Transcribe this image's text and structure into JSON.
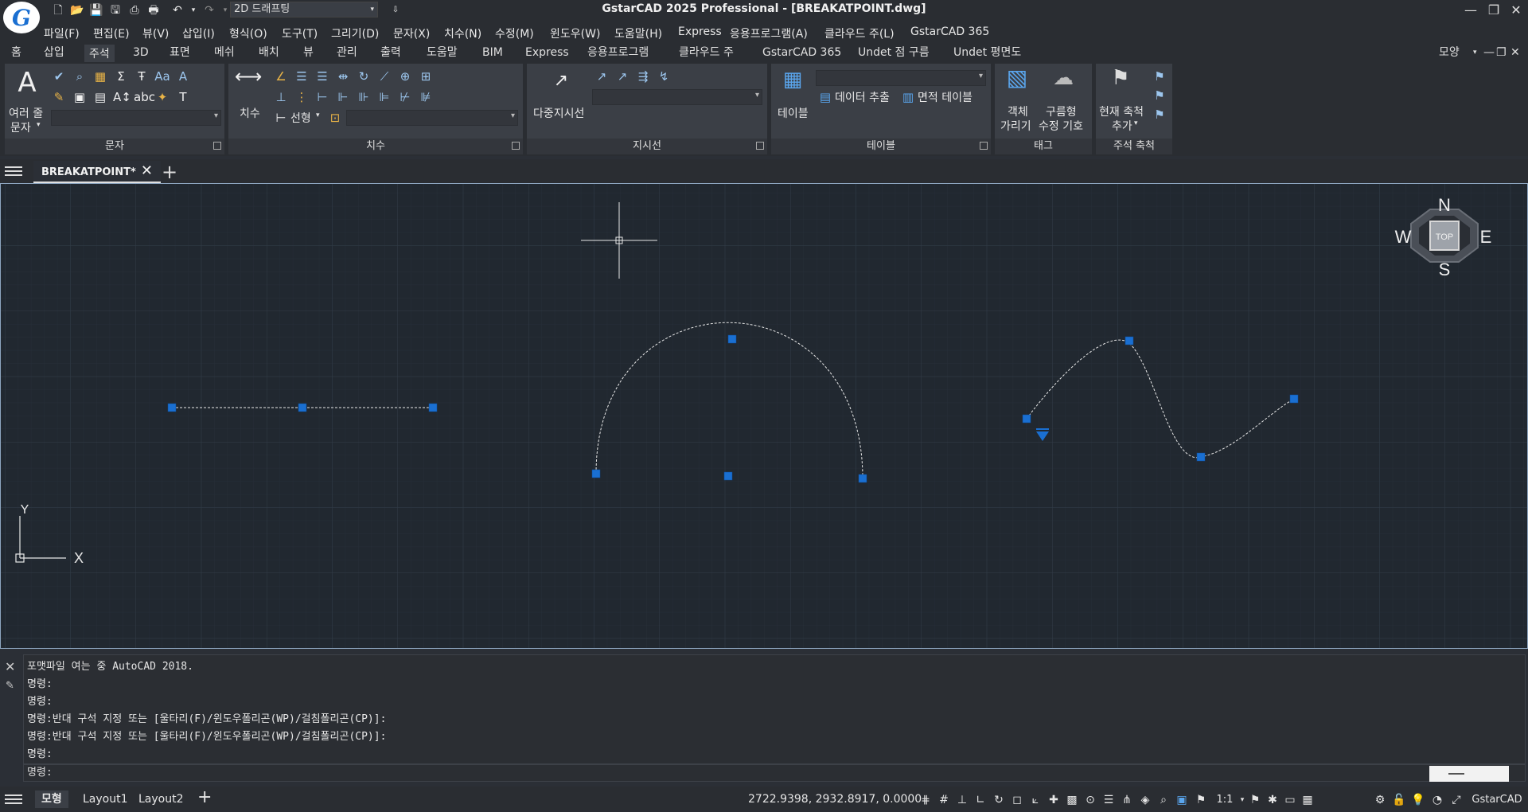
{
  "app": {
    "title": "GstarCAD 2025 Professional - [BREAKATPOINT.dwg]",
    "logo_letter": "G",
    "workspace": "2D 드래프팅"
  },
  "menus": [
    "파일(F)",
    "편집(E)",
    "뷰(V)",
    "삽입(I)",
    "형식(O)",
    "도구(T)",
    "그리기(D)",
    "문자(X)",
    "치수(N)",
    "수정(M)",
    "윈도우(W)",
    "도움말(H)",
    "Express",
    "응용프로그램(A)",
    "클라우드 주(L)",
    "GstarCAD 365"
  ],
  "ribbon_tabs": [
    "홈",
    "삽입",
    "주석",
    "3D",
    "표면",
    "메쉬",
    "배치",
    "뷰",
    "관리",
    "출력",
    "도움말",
    "BIM",
    "Express",
    "응용프로그램",
    "클라우드 주",
    "GstarCAD 365",
    "Undet 점 구름",
    "Undet 평면도"
  ],
  "ribbon_active_tab": "주석",
  "ribbon_right_label": "모양",
  "panels": {
    "text": {
      "title": "문자",
      "big_label_1": "여러 줄",
      "big_label_2": "문자"
    },
    "dim": {
      "title": "치수",
      "big_label": "치수",
      "linear_label": "선형"
    },
    "leader": {
      "title": "지시선",
      "big_label": "다중지시선"
    },
    "table": {
      "title": "테이블",
      "big_label": "테이블",
      "extract_label": "데이터 추출",
      "area_label": "면적 테이블"
    },
    "tag": {
      "title": "태그",
      "hide_label_1": "객체",
      "hide_label_2": "가리기",
      "cloud_label_1": "구름형",
      "cloud_label_2": "수정 기호"
    },
    "scale": {
      "title": "주석 축척",
      "add_label_1": "현재 축척",
      "add_label_2": "추가"
    }
  },
  "doc_tab": {
    "label": "BREAKATPOINT*"
  },
  "viewcube": {
    "n": "N",
    "s": "S",
    "e": "E",
    "w": "W",
    "top": "TOP"
  },
  "ucs": {
    "x": "X",
    "y": "Y"
  },
  "command_history": [
    "포맷파일 여는 중 AutoCAD 2018.",
    "명령:",
    "명령:",
    "명령:반대 구석 지정 또는 [울타리(F)/윈도우폴리곤(WP)/걸침폴리곤(CP)]:",
    "명령:반대 구석 지정 또는 [울타리(F)/윈도우폴리곤(WP)/걸침폴리곤(CP)]:",
    "명령:"
  ],
  "command_prompt": "명령:",
  "status": {
    "tabs": [
      "모형",
      "Layout1",
      "Layout2"
    ],
    "active_tab": "모형",
    "coordinates": "2722.9398, 2932.8917, 0.0000",
    "scale": "1:1",
    "brand": "GstarCAD"
  },
  "colors": {
    "canvas_bg": "#212830",
    "grip_blue": "#1a6fd1",
    "accent": "#1a6fd1"
  }
}
